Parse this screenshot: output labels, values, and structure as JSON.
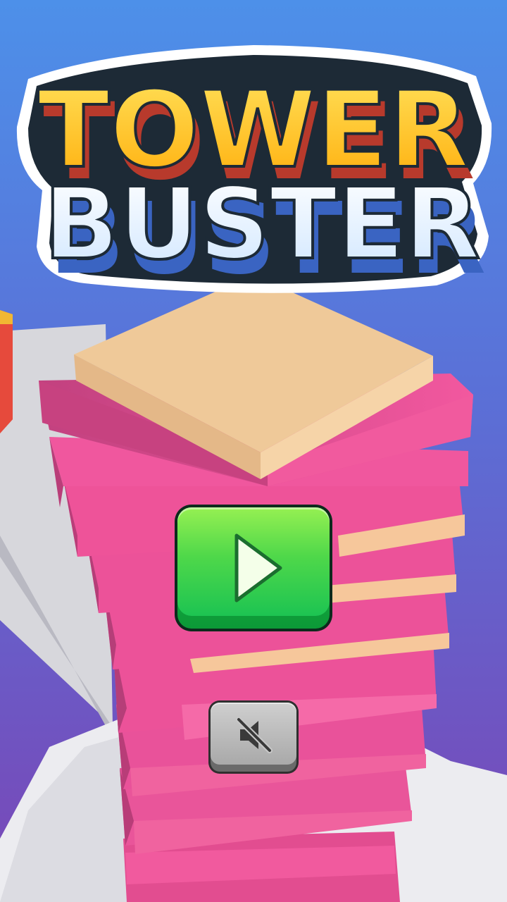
{
  "title": {
    "line1": "TOWER",
    "line2": "BUSTER"
  },
  "buttons": {
    "play_icon": "play-icon",
    "sound_icon": "speaker-muted-icon"
  },
  "colors": {
    "sky_top": "#4f8fe8",
    "sky_bottom": "#7a4ab8",
    "block_pink": "#f24f9a",
    "block_top": "#efc999",
    "play_green": "#4fd84a",
    "title_yellow": "#ffc21a",
    "title_white": "#e8f4ff"
  }
}
